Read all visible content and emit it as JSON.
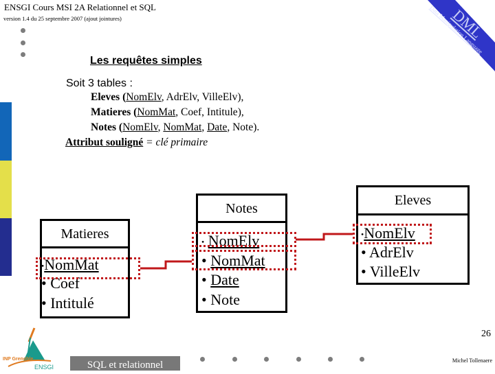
{
  "header": {
    "course_title": "ENSGI Cours MSI 2A Relationnel et SQL",
    "version": "version 1.4  du 25 septembre 2007 (ajout jointures)"
  },
  "banner": {
    "acronym": "DML",
    "subtitle": "Data Manipulation Language",
    "color": "#2f35c8"
  },
  "slide": {
    "title": "Les requêtes simples",
    "intro": "Soit 3 tables :",
    "tables": [
      {
        "name": "Eleves",
        "open": " (",
        "attrs": [
          {
            "text": "NomElv",
            "key": true
          },
          {
            "text": "AdrElv",
            "key": false
          },
          {
            "text": "VilleElv",
            "key": false
          }
        ],
        "close": "),"
      },
      {
        "name": "Matieres",
        "open": " (",
        "attrs": [
          {
            "text": "NomMat",
            "key": true
          },
          {
            "text": "Coef",
            "key": false
          },
          {
            "text": "Intitule",
            "key": false
          }
        ],
        "close": "),"
      },
      {
        "name": "Notes",
        "open": " (",
        "attrs": [
          {
            "text": "NomElv",
            "key": true
          },
          {
            "text": "NomMat",
            "key": true
          },
          {
            "text": "Date",
            "key": true
          },
          {
            "text": "Note",
            "key": false
          }
        ],
        "close": ")."
      }
    ],
    "legend_key": "Attribut souligné",
    "legend_rest": " = clé primaire"
  },
  "side_bars": [
    {
      "color": "#1266b8"
    },
    {
      "color": "#e4df4a"
    },
    {
      "color": "#232d8f"
    }
  ],
  "diagram": {
    "matieres": {
      "title": "Matieres",
      "attrs": [
        "NomMat",
        "Coef",
        "Intitulé"
      ]
    },
    "notes": {
      "title": "Notes",
      "attrs": [
        "NomElv",
        "NomMat",
        "Date",
        "Note"
      ]
    },
    "eleves": {
      "title": "Eleves",
      "attrs": [
        "NomElv",
        "AdrElv",
        "VilleElv"
      ]
    },
    "bullet": "•",
    "link_color": "#c0171a"
  },
  "footer": {
    "label": "SQL et relationnel",
    "page": "26",
    "author": "Michel Tollenaere",
    "logo_top": "INP Grenoble",
    "logo_bottom": "ENSGI"
  }
}
